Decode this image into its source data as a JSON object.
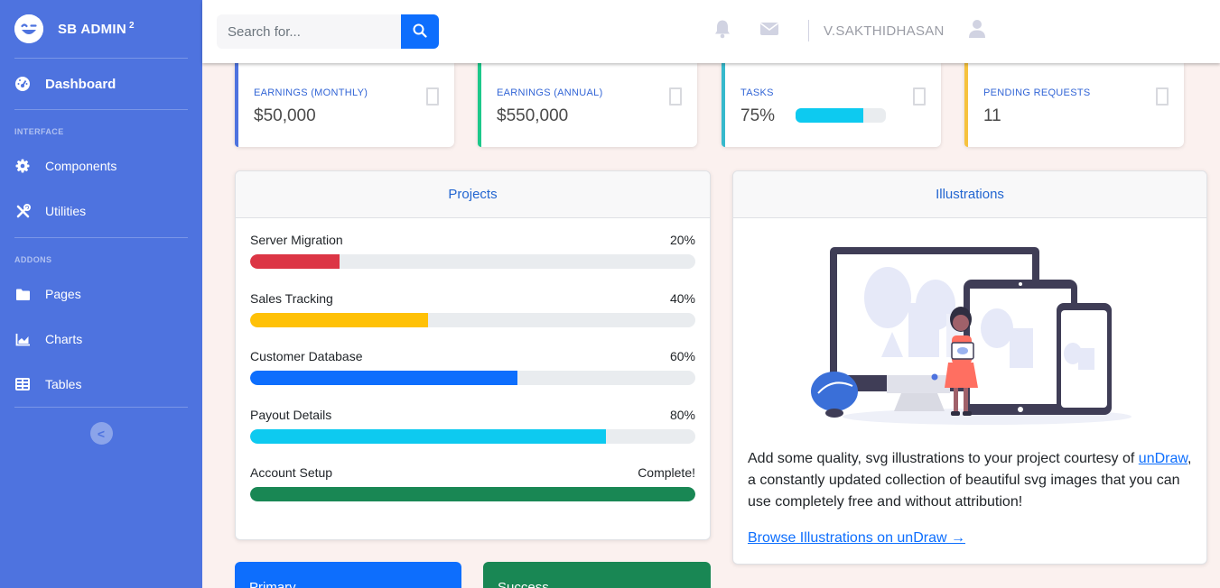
{
  "sidebar": {
    "brand": {
      "name": "SB ADMIN",
      "superscript": "2"
    },
    "dashboard": {
      "label": "Dashboard",
      "icon": "dashboard-gauge-icon"
    },
    "interface_heading": "INTERFACE",
    "interface_items": [
      {
        "label": "Components",
        "icon": "cog-icon"
      },
      {
        "label": "Utilities",
        "icon": "wrench-icon"
      }
    ],
    "addons_heading": "ADDONS",
    "addons_items": [
      {
        "label": "Pages",
        "icon": "folder-icon"
      },
      {
        "label": "Charts",
        "icon": "chart-area-icon"
      },
      {
        "label": "Tables",
        "icon": "table-icon"
      }
    ],
    "toggle_glyph": "<"
  },
  "topbar": {
    "search_placeholder": "Search for...",
    "user_name": "V.SAKTHIDHASAN",
    "icons": [
      "bell-icon",
      "envelope-icon",
      "user-icon"
    ]
  },
  "stats": [
    {
      "label": "EARNINGS (MONTHLY)",
      "value": "$50,000",
      "color": "#4e73df"
    },
    {
      "label": "EARNINGS (ANNUAL)",
      "value": "$550,000",
      "color": "#1cc88a"
    },
    {
      "label": "TASKS",
      "value": "75%",
      "color": "#36b9cc",
      "progress": 0.75
    },
    {
      "label": "PENDING REQUESTS",
      "value": "11",
      "color": "#f6c23e"
    }
  ],
  "projects": {
    "title": "Projects",
    "items": [
      {
        "name": "Server Migration",
        "percent_label": "20%",
        "progress": 0.2,
        "color": "#dc3545"
      },
      {
        "name": "Sales Tracking",
        "percent_label": "40%",
        "progress": 0.4,
        "color": "#ffc107"
      },
      {
        "name": "Customer Database",
        "percent_label": "60%",
        "progress": 0.6,
        "color": "#0d6efd"
      },
      {
        "name": "Payout Details",
        "percent_label": "80%",
        "progress": 0.8,
        "color": "#0dcaf0"
      },
      {
        "name": "Account Setup",
        "percent_label": "Complete!",
        "progress": 1.0,
        "color": "#198754"
      }
    ]
  },
  "illustrations": {
    "title": "Illustrations",
    "text_before": "Add some quality, svg illustrations to your project courtesy of ",
    "link_undraw": "unDraw",
    "text_after": ", a constantly updated collection of beautiful svg images that you can use completely free and without attribution!",
    "browse_link": "Browse Illustrations on unDraw →"
  },
  "bottom_cards": [
    {
      "label": "Primary",
      "color": "#0d6efd"
    },
    {
      "label": "Success",
      "color": "#198754"
    }
  ]
}
